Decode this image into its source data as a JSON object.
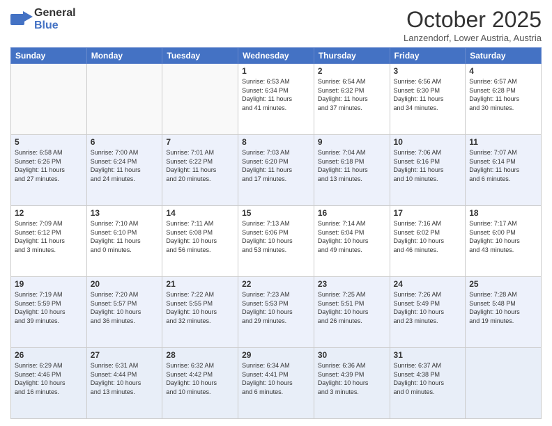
{
  "header": {
    "logo_general": "General",
    "logo_blue": "Blue",
    "month_title": "October 2025",
    "location": "Lanzendorf, Lower Austria, Austria"
  },
  "weekdays": [
    "Sunday",
    "Monday",
    "Tuesday",
    "Wednesday",
    "Thursday",
    "Friday",
    "Saturday"
  ],
  "weeks": [
    [
      {
        "day": "",
        "info": ""
      },
      {
        "day": "",
        "info": ""
      },
      {
        "day": "",
        "info": ""
      },
      {
        "day": "1",
        "info": "Sunrise: 6:53 AM\nSunset: 6:34 PM\nDaylight: 11 hours\nand 41 minutes."
      },
      {
        "day": "2",
        "info": "Sunrise: 6:54 AM\nSunset: 6:32 PM\nDaylight: 11 hours\nand 37 minutes."
      },
      {
        "day": "3",
        "info": "Sunrise: 6:56 AM\nSunset: 6:30 PM\nDaylight: 11 hours\nand 34 minutes."
      },
      {
        "day": "4",
        "info": "Sunrise: 6:57 AM\nSunset: 6:28 PM\nDaylight: 11 hours\nand 30 minutes."
      }
    ],
    [
      {
        "day": "5",
        "info": "Sunrise: 6:58 AM\nSunset: 6:26 PM\nDaylight: 11 hours\nand 27 minutes."
      },
      {
        "day": "6",
        "info": "Sunrise: 7:00 AM\nSunset: 6:24 PM\nDaylight: 11 hours\nand 24 minutes."
      },
      {
        "day": "7",
        "info": "Sunrise: 7:01 AM\nSunset: 6:22 PM\nDaylight: 11 hours\nand 20 minutes."
      },
      {
        "day": "8",
        "info": "Sunrise: 7:03 AM\nSunset: 6:20 PM\nDaylight: 11 hours\nand 17 minutes."
      },
      {
        "day": "9",
        "info": "Sunrise: 7:04 AM\nSunset: 6:18 PM\nDaylight: 11 hours\nand 13 minutes."
      },
      {
        "day": "10",
        "info": "Sunrise: 7:06 AM\nSunset: 6:16 PM\nDaylight: 11 hours\nand 10 minutes."
      },
      {
        "day": "11",
        "info": "Sunrise: 7:07 AM\nSunset: 6:14 PM\nDaylight: 11 hours\nand 6 minutes."
      }
    ],
    [
      {
        "day": "12",
        "info": "Sunrise: 7:09 AM\nSunset: 6:12 PM\nDaylight: 11 hours\nand 3 minutes."
      },
      {
        "day": "13",
        "info": "Sunrise: 7:10 AM\nSunset: 6:10 PM\nDaylight: 11 hours\nand 0 minutes."
      },
      {
        "day": "14",
        "info": "Sunrise: 7:11 AM\nSunset: 6:08 PM\nDaylight: 10 hours\nand 56 minutes."
      },
      {
        "day": "15",
        "info": "Sunrise: 7:13 AM\nSunset: 6:06 PM\nDaylight: 10 hours\nand 53 minutes."
      },
      {
        "day": "16",
        "info": "Sunrise: 7:14 AM\nSunset: 6:04 PM\nDaylight: 10 hours\nand 49 minutes."
      },
      {
        "day": "17",
        "info": "Sunrise: 7:16 AM\nSunset: 6:02 PM\nDaylight: 10 hours\nand 46 minutes."
      },
      {
        "day": "18",
        "info": "Sunrise: 7:17 AM\nSunset: 6:00 PM\nDaylight: 10 hours\nand 43 minutes."
      }
    ],
    [
      {
        "day": "19",
        "info": "Sunrise: 7:19 AM\nSunset: 5:59 PM\nDaylight: 10 hours\nand 39 minutes."
      },
      {
        "day": "20",
        "info": "Sunrise: 7:20 AM\nSunset: 5:57 PM\nDaylight: 10 hours\nand 36 minutes."
      },
      {
        "day": "21",
        "info": "Sunrise: 7:22 AM\nSunset: 5:55 PM\nDaylight: 10 hours\nand 32 minutes."
      },
      {
        "day": "22",
        "info": "Sunrise: 7:23 AM\nSunset: 5:53 PM\nDaylight: 10 hours\nand 29 minutes."
      },
      {
        "day": "23",
        "info": "Sunrise: 7:25 AM\nSunset: 5:51 PM\nDaylight: 10 hours\nand 26 minutes."
      },
      {
        "day": "24",
        "info": "Sunrise: 7:26 AM\nSunset: 5:49 PM\nDaylight: 10 hours\nand 23 minutes."
      },
      {
        "day": "25",
        "info": "Sunrise: 7:28 AM\nSunset: 5:48 PM\nDaylight: 10 hours\nand 19 minutes."
      }
    ],
    [
      {
        "day": "26",
        "info": "Sunrise: 6:29 AM\nSunset: 4:46 PM\nDaylight: 10 hours\nand 16 minutes."
      },
      {
        "day": "27",
        "info": "Sunrise: 6:31 AM\nSunset: 4:44 PM\nDaylight: 10 hours\nand 13 minutes."
      },
      {
        "day": "28",
        "info": "Sunrise: 6:32 AM\nSunset: 4:42 PM\nDaylight: 10 hours\nand 10 minutes."
      },
      {
        "day": "29",
        "info": "Sunrise: 6:34 AM\nSunset: 4:41 PM\nDaylight: 10 hours\nand 6 minutes."
      },
      {
        "day": "30",
        "info": "Sunrise: 6:36 AM\nSunset: 4:39 PM\nDaylight: 10 hours\nand 3 minutes."
      },
      {
        "day": "31",
        "info": "Sunrise: 6:37 AM\nSunset: 4:38 PM\nDaylight: 10 hours\nand 0 minutes."
      },
      {
        "day": "",
        "info": ""
      }
    ]
  ]
}
